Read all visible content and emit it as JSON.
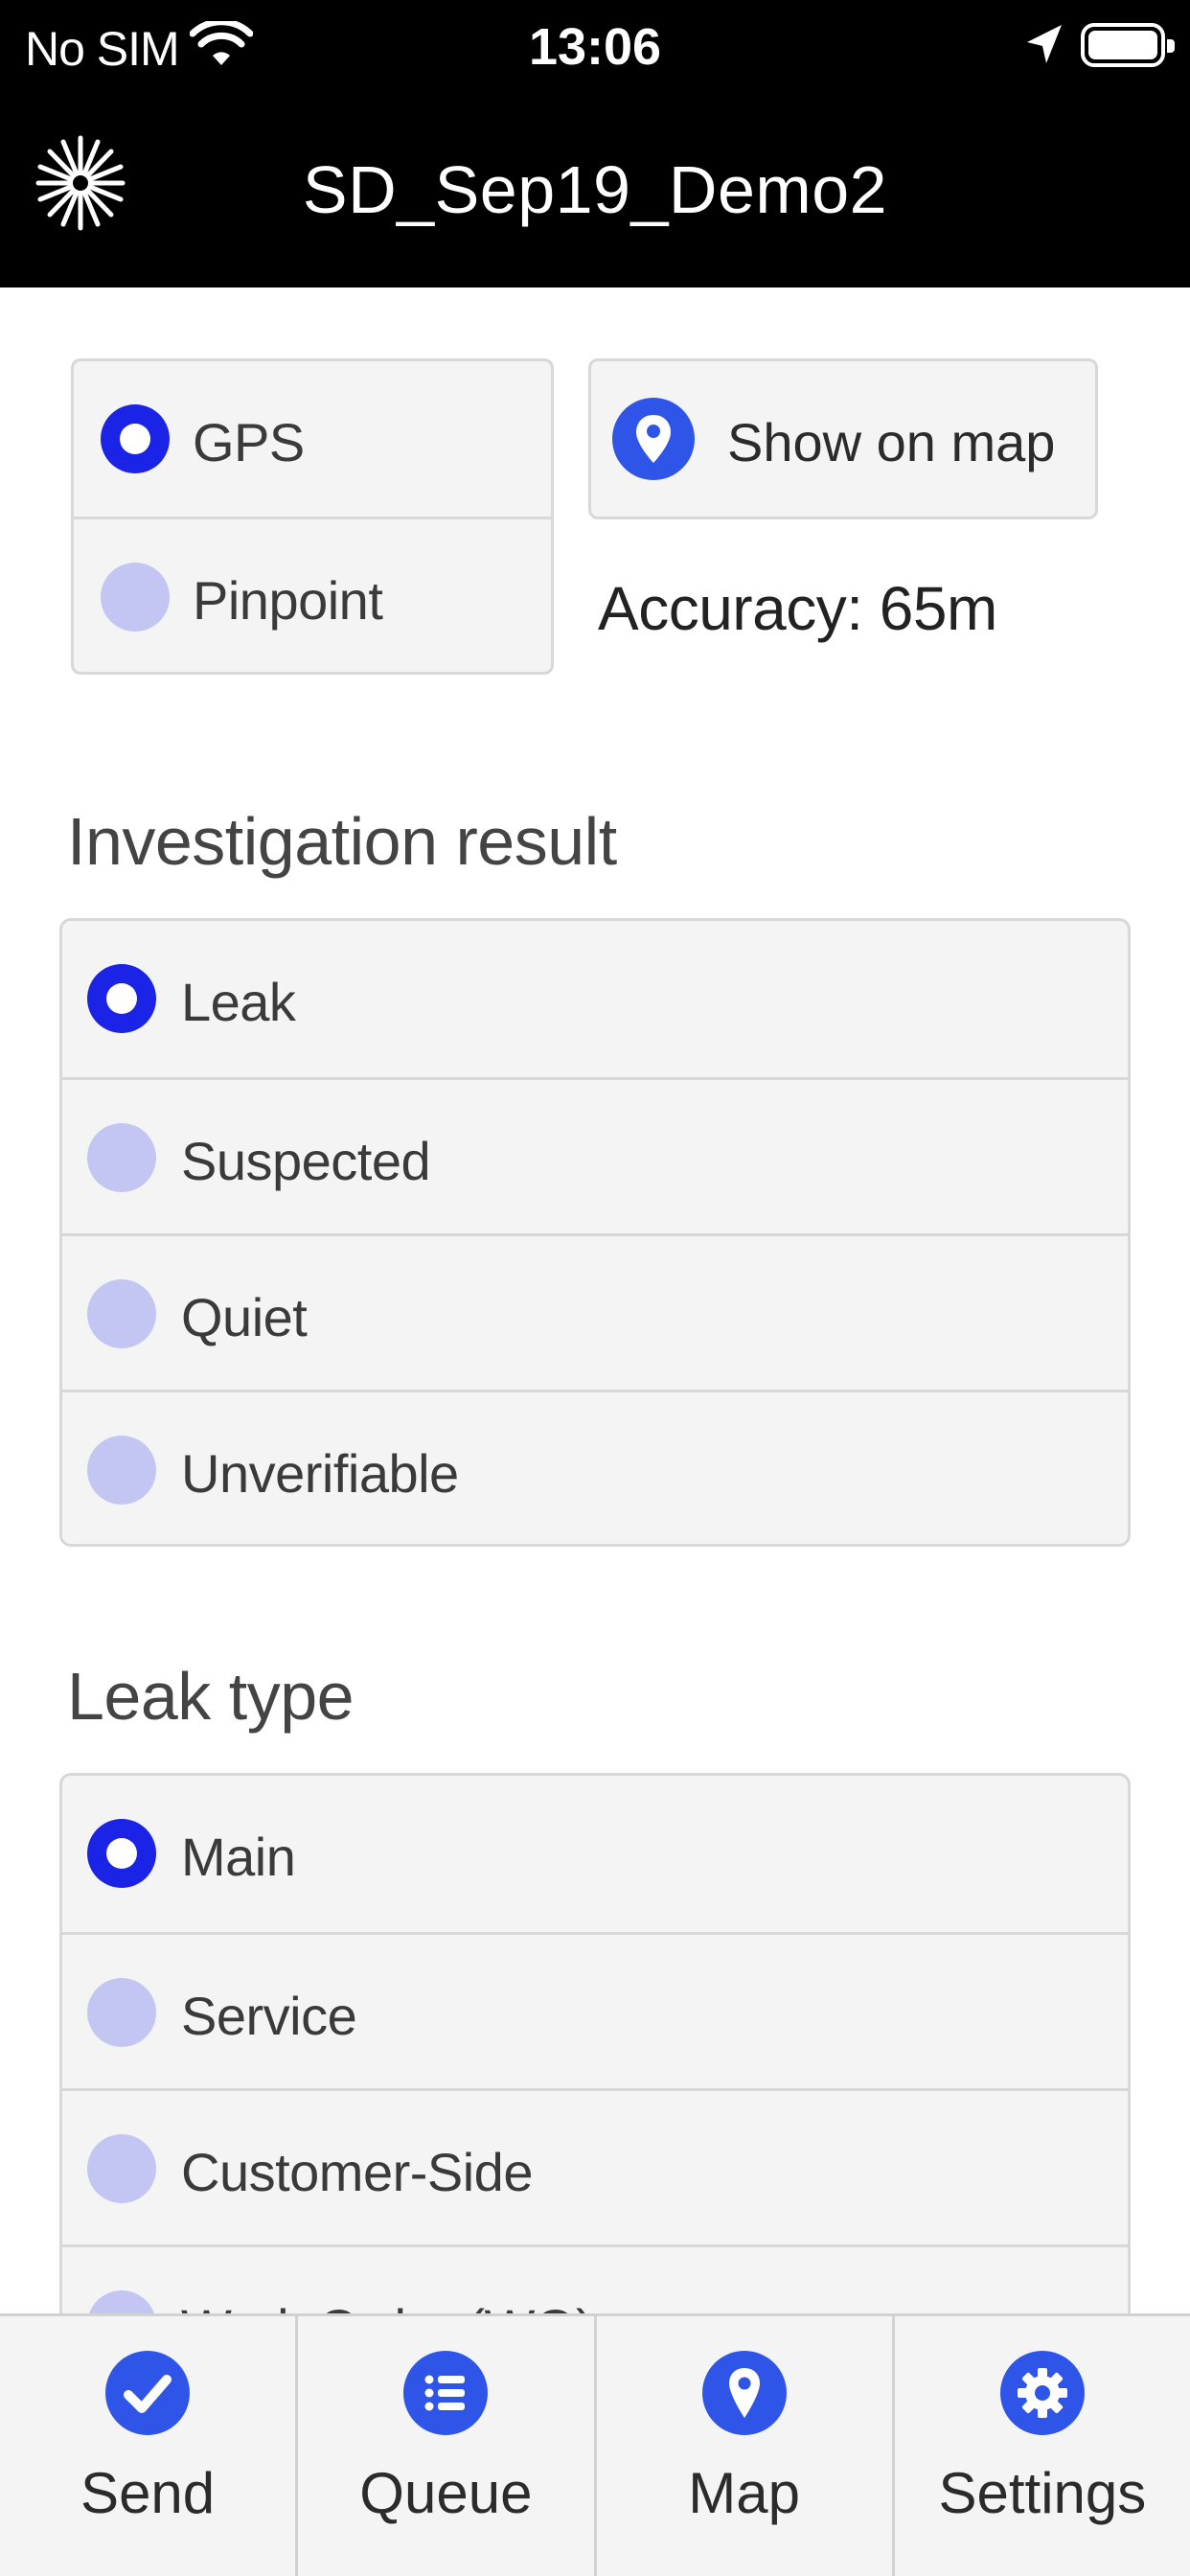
{
  "status_bar": {
    "carrier": "No SIM",
    "time": "13:06"
  },
  "header": {
    "title": "SD_Sep19_Demo2"
  },
  "location": {
    "options": [
      {
        "label": "GPS",
        "selected": true
      },
      {
        "label": "Pinpoint",
        "selected": false
      }
    ],
    "show_on_map_label": "Show on map",
    "accuracy_text": "Accuracy: 65m"
  },
  "investigation": {
    "title": "Investigation result",
    "options": [
      {
        "label": "Leak",
        "selected": true
      },
      {
        "label": "Suspected",
        "selected": false
      },
      {
        "label": "Quiet",
        "selected": false
      },
      {
        "label": "Unverifiable",
        "selected": false
      }
    ]
  },
  "leak_type": {
    "title": "Leak type",
    "options": [
      {
        "label": "Main",
        "selected": true
      },
      {
        "label": "Service",
        "selected": false
      },
      {
        "label": "Customer-Side",
        "selected": false
      },
      {
        "label": "Work Order (WO)",
        "selected": false
      }
    ]
  },
  "tabbar": {
    "tabs": [
      {
        "label": "Send",
        "icon": "check-circle-icon"
      },
      {
        "label": "Queue",
        "icon": "list-icon"
      },
      {
        "label": "Map",
        "icon": "map-pin-icon"
      },
      {
        "label": "Settings",
        "icon": "gear-icon"
      }
    ]
  },
  "colors": {
    "accent": "#1a23e6",
    "icon_blue": "#2f55e8",
    "radio_off": "#c3c6f2",
    "header_bg": "#000000"
  }
}
